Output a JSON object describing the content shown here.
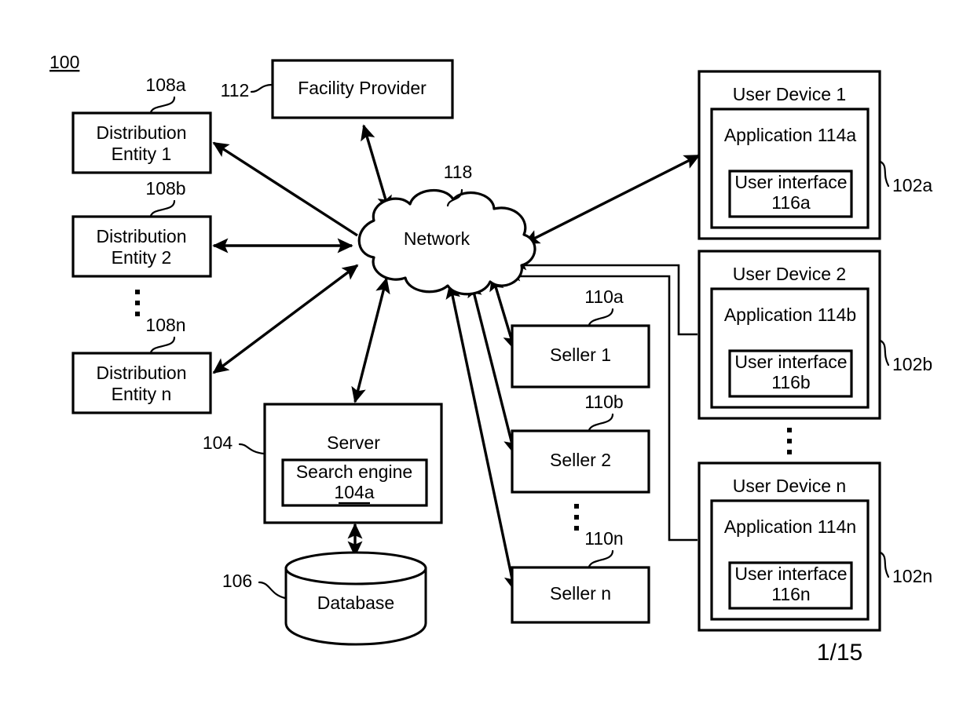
{
  "figure": {
    "number": "100",
    "page_label": "1/15"
  },
  "nodes": {
    "facility_provider": {
      "label": "Facility Provider",
      "ref": "112"
    },
    "network": {
      "label": "Network",
      "ref": "118"
    },
    "server": {
      "label": "Server",
      "ref": "104"
    },
    "search_engine": {
      "label": "Search engine",
      "ref": "104a"
    },
    "database": {
      "label": "Database",
      "ref": "106"
    },
    "distribution_entities": [
      {
        "line1": "Distribution",
        "line2": "Entity 1",
        "ref": "108a"
      },
      {
        "line1": "Distribution",
        "line2": "Entity 2",
        "ref": "108b"
      },
      {
        "line1": "Distribution",
        "line2": "Entity n",
        "ref": "108n"
      }
    ],
    "sellers": [
      {
        "label": "Seller 1",
        "ref": "110a"
      },
      {
        "label": "Seller 2",
        "ref": "110b"
      },
      {
        "label": "Seller n",
        "ref": "110n"
      }
    ],
    "user_devices": [
      {
        "title": "User Device 1",
        "application": "Application 114a",
        "ui_line1": "User interface",
        "ui_line2": "116a",
        "ref": "102a"
      },
      {
        "title": "User Device 2",
        "application": "Application 114b",
        "ui_line1": "User interface",
        "ui_line2": "116b",
        "ref": "102b"
      },
      {
        "title": "User Device n",
        "application": "Application 114n",
        "ui_line1": "User interface",
        "ui_line2": "116n",
        "ref": "102n"
      }
    ]
  },
  "colors": {
    "stroke": "#000000",
    "fill": "#ffffff"
  }
}
